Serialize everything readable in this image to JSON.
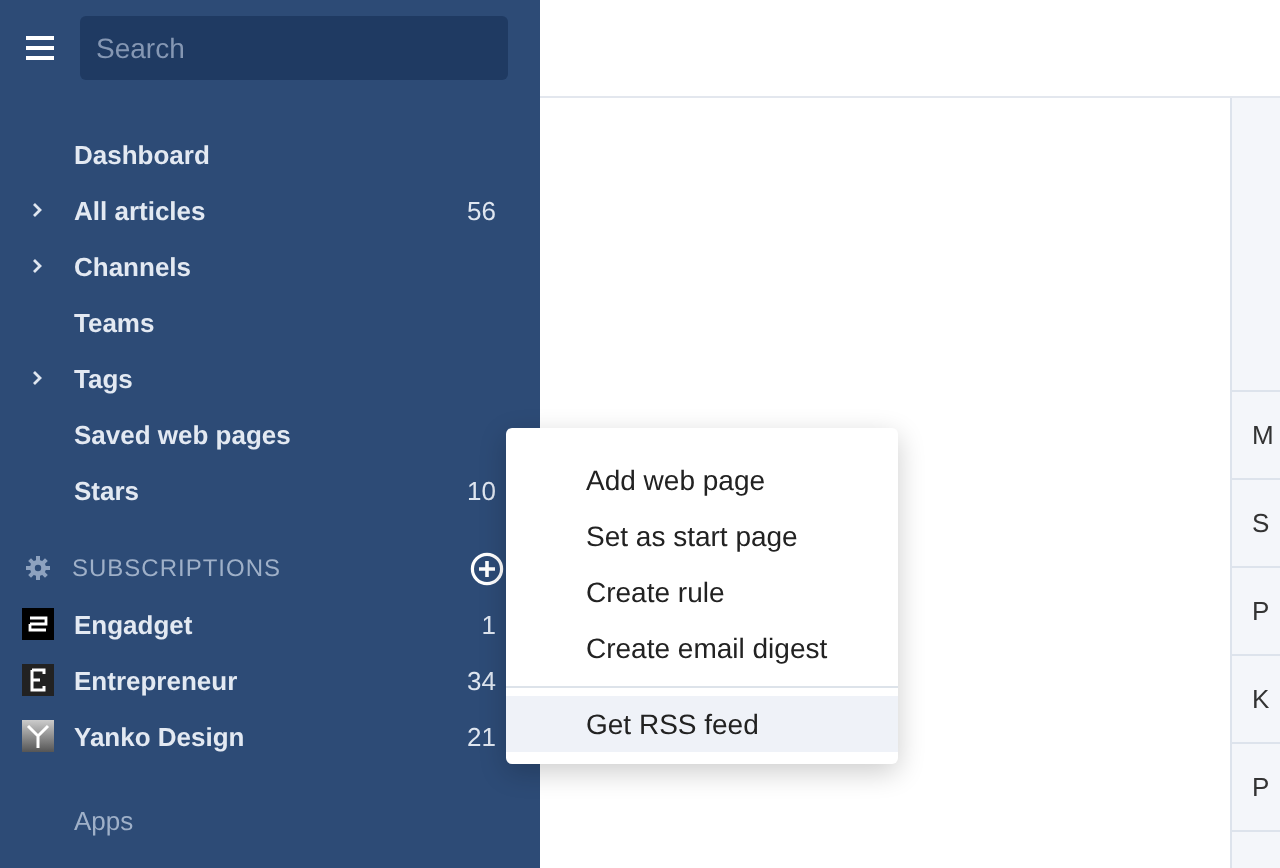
{
  "search": {
    "placeholder": "Search"
  },
  "nav": [
    {
      "label": "Dashboard",
      "expandable": false
    },
    {
      "label": "All articles",
      "expandable": true,
      "count": "56"
    },
    {
      "label": "Channels",
      "expandable": true
    },
    {
      "label": "Teams",
      "expandable": false
    },
    {
      "label": "Tags",
      "expandable": true
    },
    {
      "label": "Saved web pages",
      "expandable": false
    },
    {
      "label": "Stars",
      "expandable": false,
      "count": "10"
    }
  ],
  "subscriptions": {
    "title": "SUBSCRIPTIONS",
    "feeds": [
      {
        "name": "Engadget",
        "count": "1",
        "kind": "engadget"
      },
      {
        "name": "Entrepreneur",
        "count": "34",
        "kind": "entrepreneur"
      },
      {
        "name": "Yanko Design",
        "count": "21",
        "kind": "yanko"
      }
    ]
  },
  "apps": "Apps",
  "context_menu": {
    "items": [
      {
        "label": "Add web page",
        "selected": false
      },
      {
        "label": "Set as start page",
        "selected": false
      },
      {
        "label": "Create rule",
        "selected": false
      },
      {
        "label": "Create email digest",
        "selected": false
      }
    ],
    "footer_items": [
      {
        "label": "Get RSS feed",
        "selected": true
      }
    ]
  },
  "list_rows": [
    "M",
    "S",
    "P",
    "K",
    "P"
  ]
}
